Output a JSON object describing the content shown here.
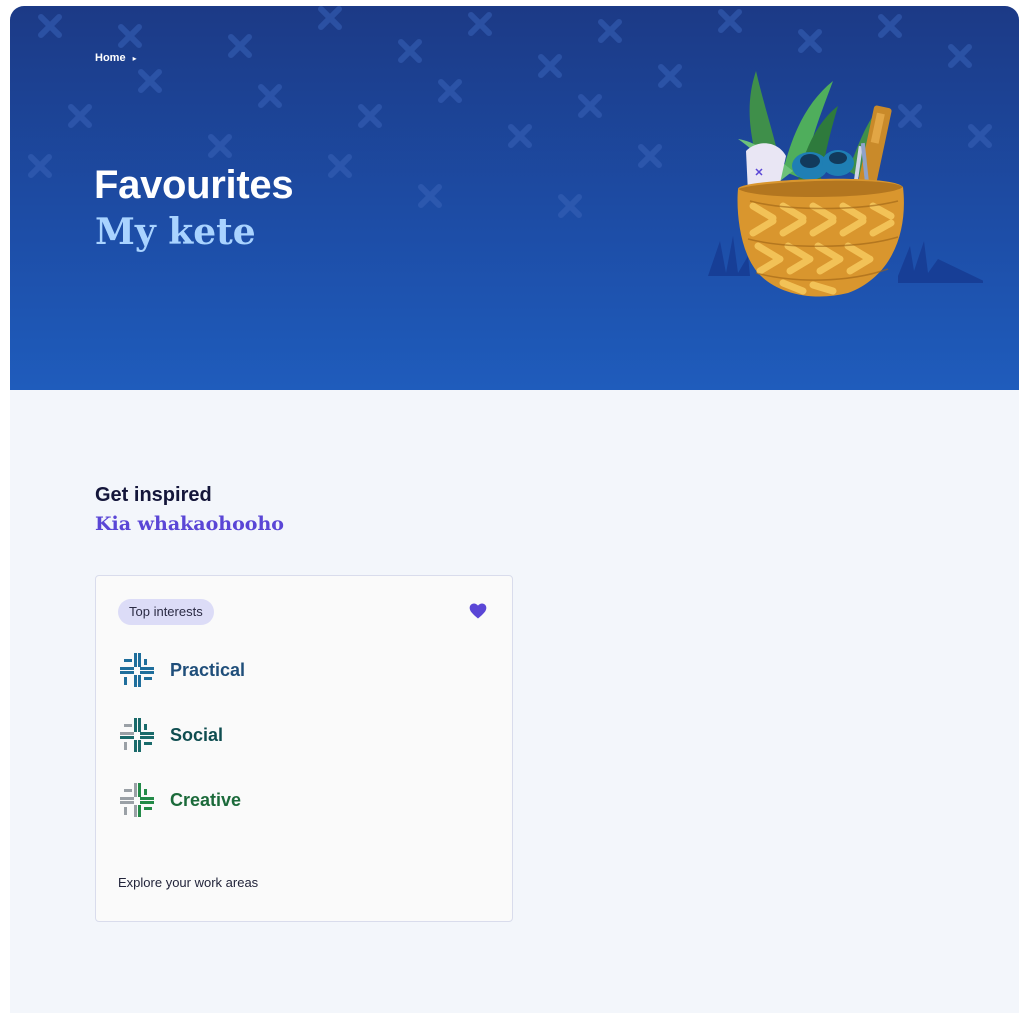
{
  "breadcrumb": {
    "home": "Home",
    "arrow": "▸"
  },
  "hero": {
    "title": "Favourites",
    "subtitle": "My kete"
  },
  "section": {
    "title": "Get inspired",
    "subtitle": "Kia whakaohooho"
  },
  "card": {
    "badge": "Top interests",
    "favourited": true,
    "footer": "Explore your work areas",
    "interests": [
      {
        "label": "Practical",
        "color": "#1f4e7a",
        "icon": "practical-weave-icon"
      },
      {
        "label": "Social",
        "color": "#0f4d50",
        "icon": "social-weave-icon"
      },
      {
        "label": "Creative",
        "color": "#1b6a3a",
        "icon": "creative-weave-icon"
      }
    ]
  },
  "colors": {
    "hero_top": "#1c3a86",
    "hero_bottom": "#1f5cbc",
    "accent_purple": "#5a46d6",
    "heart": "#5a46d6",
    "page_bg": "#f3f6fb"
  }
}
